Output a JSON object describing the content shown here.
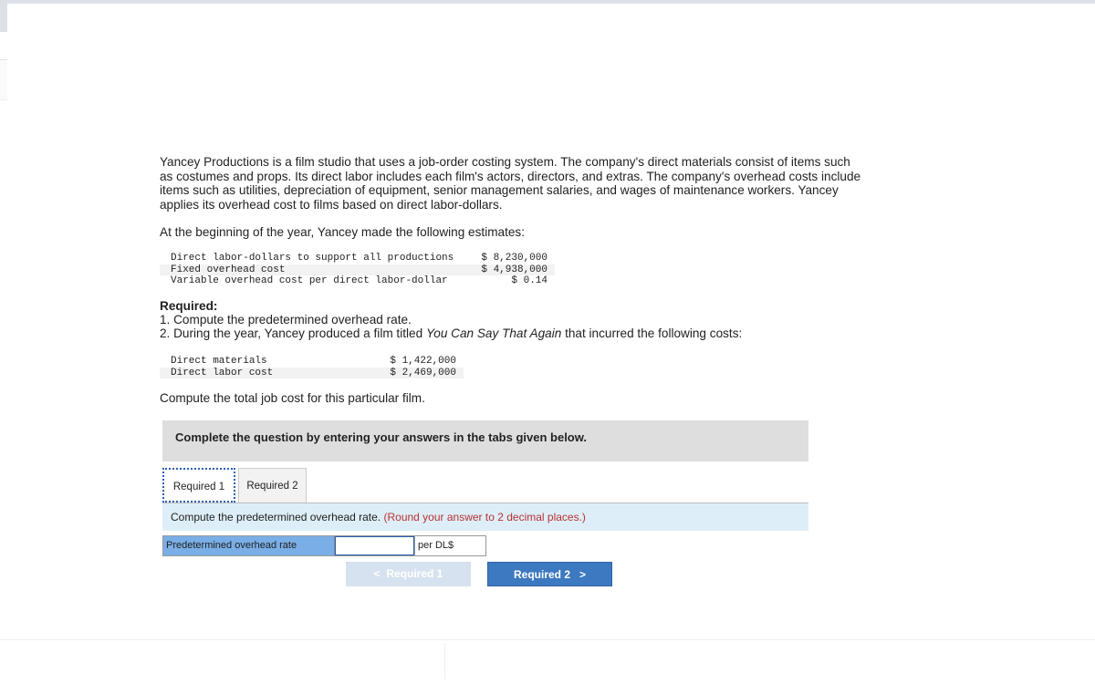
{
  "problem": {
    "intro": "Yancey Productions is a film studio that uses a job-order costing system. The company's direct materials consist of items such as costumes and props. Its direct labor includes each film's actors, directors, and extras. The company's overhead costs include items such as utilities, depreciation of equipment, senior management salaries, and wages of maintenance workers. Yancey applies its overhead cost to films based on direct labor-dollars.",
    "estimates_intro": "At the beginning of the year, Yancey made the following estimates:",
    "estimates": [
      {
        "label": "Direct labor-dollars to support all productions",
        "value": "$ 8,230,000"
      },
      {
        "label": "Fixed overhead cost",
        "value": "$ 4,938,000"
      },
      {
        "label": "Variable overhead cost per direct labor-dollar",
        "value": "$ 0.14"
      }
    ],
    "required_heading": "Required:",
    "req1": "1. Compute the predetermined overhead rate.",
    "req2_pre": "2. During the year, Yancey produced a film titled ",
    "req2_title": "You Can Say That Again",
    "req2_post": " that incurred the following costs:",
    "costs": [
      {
        "label": "Direct materials",
        "value": "$ 1,422,000"
      },
      {
        "label": "Direct labor cost",
        "value": "$ 2,469,000"
      }
    ],
    "closing": "Compute the total job cost for this particular film."
  },
  "instructions": "Complete the question by entering your answers in the tabs given below.",
  "tabs": [
    {
      "label": "Required 1",
      "active": true
    },
    {
      "label": "Required 2",
      "active": false
    }
  ],
  "question": {
    "text": "Compute the predetermined overhead rate.",
    "note": "(Round your answer to 2 decimal places.)"
  },
  "answer": {
    "label": "Predetermined overhead rate",
    "value": "",
    "unit": "per DL$"
  },
  "nav": {
    "prev_label": "Required 1",
    "next_label": "Required 2"
  },
  "colors": {
    "accent": "#3c79c0",
    "label_bg": "#7aaee6",
    "note": "#b83232",
    "question_bg": "#ddeef8"
  }
}
